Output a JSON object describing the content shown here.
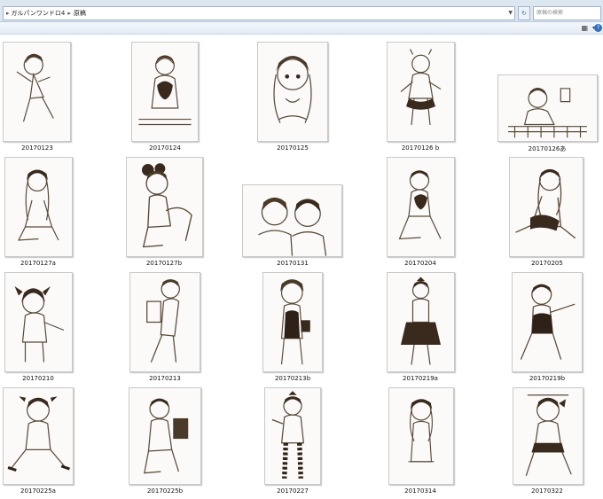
{
  "address": {
    "segments": [
      "ガルパンワンドロ4",
      "原稿"
    ]
  },
  "search": {
    "placeholder": "原稿の検索"
  },
  "items": [
    {
      "name": "20170123"
    },
    {
      "name": "20170124"
    },
    {
      "name": "20170125"
    },
    {
      "name": "20170126 b"
    },
    {
      "name": "20170126あ"
    },
    {
      "name": "20170127a"
    },
    {
      "name": "20170127b"
    },
    {
      "name": "20170131"
    },
    {
      "name": "20170204"
    },
    {
      "name": "20170205"
    },
    {
      "name": "20170210"
    },
    {
      "name": "20170213"
    },
    {
      "name": "20170213b"
    },
    {
      "name": "20170219a"
    },
    {
      "name": "20170219b"
    },
    {
      "name": "20170225a"
    },
    {
      "name": "20170225b"
    },
    {
      "name": "20170227"
    },
    {
      "name": "20170314"
    },
    {
      "name": "20170322"
    }
  ]
}
